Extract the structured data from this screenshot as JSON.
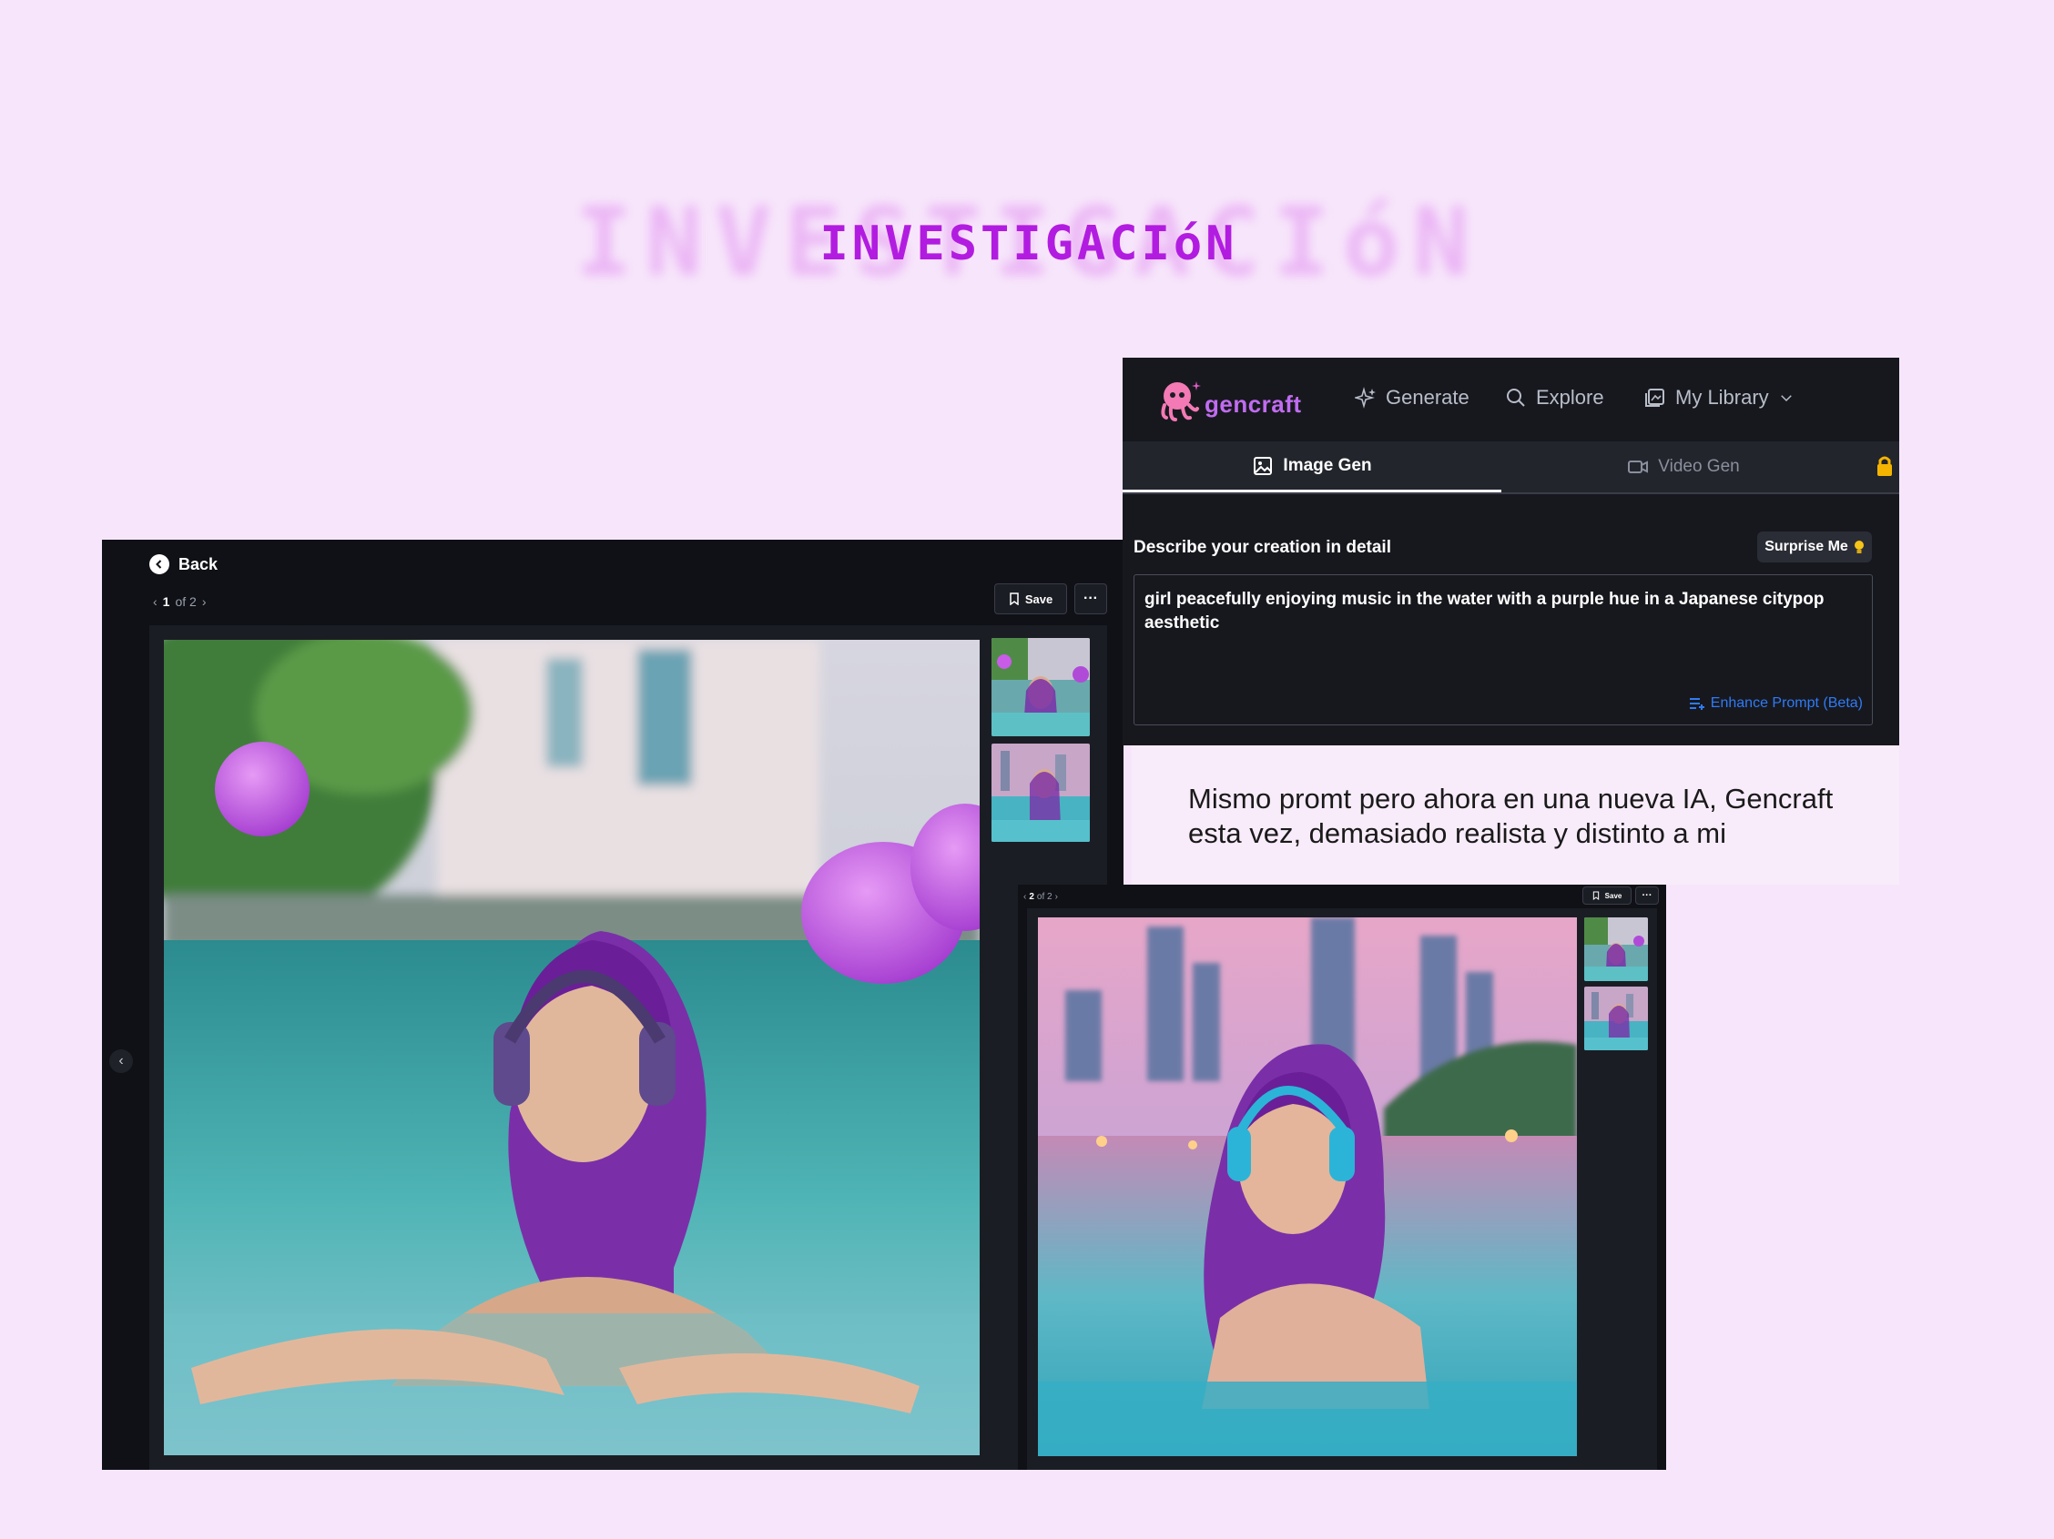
{
  "heading": {
    "title": "INVESTIGACIóN"
  },
  "gencraft": {
    "logo": "gencraft",
    "nav": {
      "generate": "Generate",
      "explore": "Explore",
      "library": "My Library"
    },
    "tabs": {
      "image": "Image Gen",
      "video": "Video Gen"
    },
    "describe_label": "Describe your creation in detail",
    "surprise_label": "Surprise Me",
    "prompt_text": "girl peacefully enjoying music in the water with a purple hue in a Japanese citypop aesthetic",
    "enhance_label": "Enhance Prompt (Beta)",
    "colors": {
      "panel_bg": "#17181e",
      "accent_logo": "#c06cf0",
      "link_blue": "#2f7bf5",
      "lock": "#f5b400"
    }
  },
  "caption": {
    "line1": "Mismo promt  pero ahora en una nueva IA, Gencraft",
    "line2": "esta vez, demasiado realista y distinto a mi"
  },
  "viewer1": {
    "back_label": "Back",
    "page_current": "1",
    "page_of": "of 2",
    "save_label": "Save",
    "more_label": "···"
  },
  "viewer2": {
    "page_current": "2",
    "page_of": "of 2",
    "save_label": "Save",
    "more_label": "···"
  },
  "icons": {
    "generate": "sparkle-icon",
    "explore": "search-icon",
    "library": "library-icon",
    "image_tab": "image-icon",
    "video_tab": "video-camera-icon",
    "lock": "lock-icon",
    "surprise": "lightbulb-icon",
    "enhance": "enhance-list-icon",
    "back": "chevron-left-icon",
    "save": "bookmark-icon"
  }
}
